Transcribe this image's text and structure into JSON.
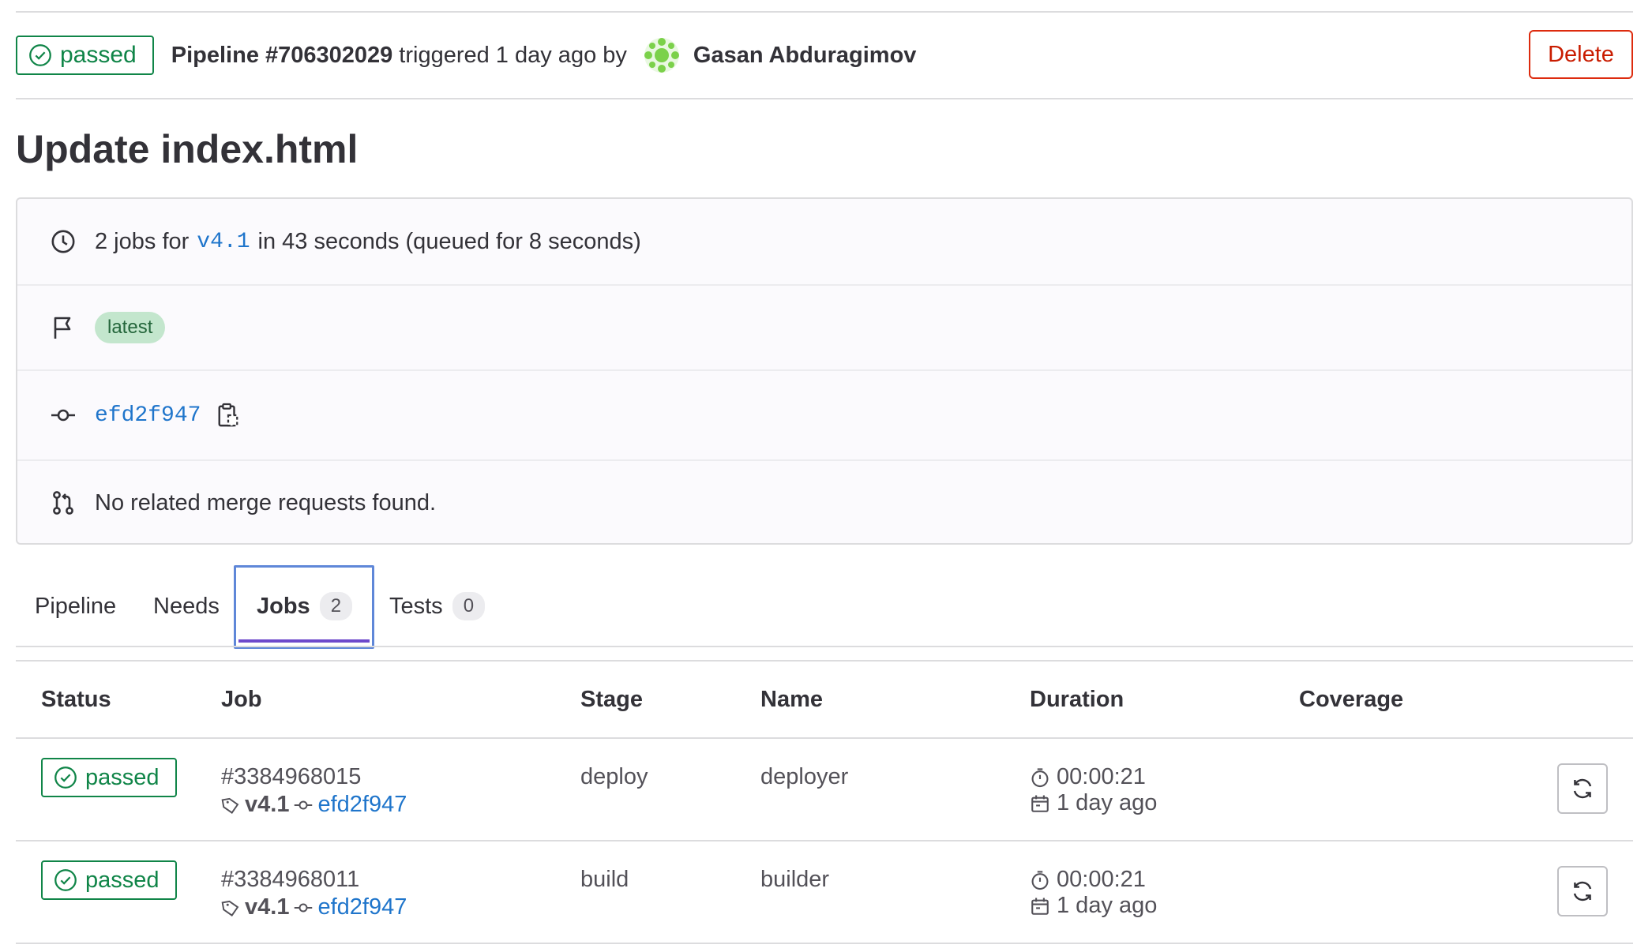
{
  "header": {
    "status": "passed",
    "pipeline_label": "Pipeline #706302029",
    "triggered_text": "triggered 1 day ago by",
    "user_name": "Gasan Abduragimov",
    "delete_label": "Delete"
  },
  "title": "Update index.html",
  "info": {
    "jobs_prefix": "2 jobs for",
    "ref": "v4.1",
    "jobs_suffix": "in 43 seconds (queued for 8 seconds)",
    "tag": "latest",
    "commit_sha": "efd2f947",
    "merge_requests": "No related merge requests found."
  },
  "tabs": [
    {
      "label": "Pipeline"
    },
    {
      "label": "Needs"
    },
    {
      "label": "Jobs",
      "count": "2"
    },
    {
      "label": "Tests",
      "count": "0"
    }
  ],
  "table": {
    "headers": [
      "Status",
      "Job",
      "Stage",
      "Name",
      "Duration",
      "Coverage"
    ],
    "rows": [
      {
        "status": "passed",
        "job_id": "#3384968015",
        "ref": "v4.1",
        "sha": "efd2f947",
        "stage": "deploy",
        "name": "deployer",
        "duration": "00:00:21",
        "finished": "1 day ago"
      },
      {
        "status": "passed",
        "job_id": "#3384968011",
        "ref": "v4.1",
        "sha": "efd2f947",
        "stage": "build",
        "name": "builder",
        "duration": "00:00:21",
        "finished": "1 day ago"
      }
    ]
  },
  "colors": {
    "success": "#108548",
    "danger": "#dd2b0e",
    "link": "#1f75cb",
    "tab_active": "#6e49cb"
  }
}
